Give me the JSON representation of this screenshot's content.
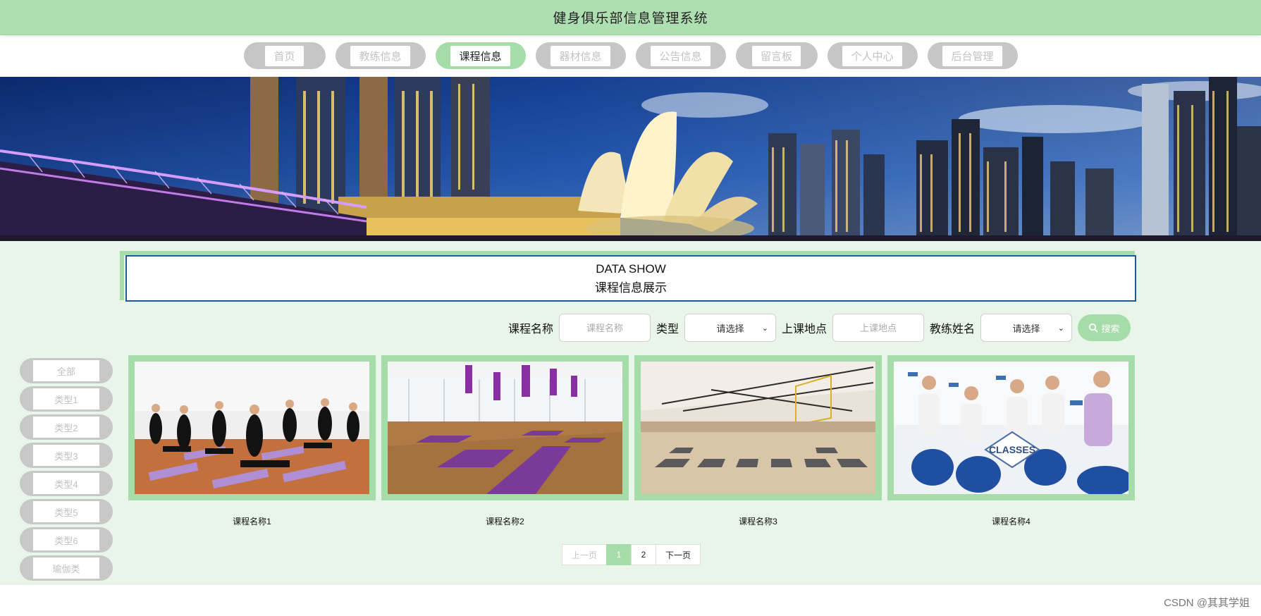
{
  "header": {
    "title": "健身俱乐部信息管理系统"
  },
  "nav": {
    "items": [
      {
        "label": "首页"
      },
      {
        "label": "教练信息"
      },
      {
        "label": "课程信息"
      },
      {
        "label": "器材信息"
      },
      {
        "label": "公告信息"
      },
      {
        "label": "留言板"
      },
      {
        "label": "个人中心"
      },
      {
        "label": "后台管理"
      }
    ],
    "active_index": 2
  },
  "section": {
    "title_en": "DATA SHOW",
    "title_cn": "课程信息展示"
  },
  "search": {
    "course_name_label": "课程名称",
    "course_name_placeholder": "课程名称",
    "type_label": "类型",
    "type_value": "请选择",
    "location_label": "上课地点",
    "location_placeholder": "上课地点",
    "coach_label": "教练姓名",
    "coach_value": "请选择",
    "button_label": "搜索",
    "button_icon": "search-icon"
  },
  "categories": [
    {
      "label": "全部"
    },
    {
      "label": "类型1"
    },
    {
      "label": "类型2"
    },
    {
      "label": "类型3"
    },
    {
      "label": "类型4"
    },
    {
      "label": "类型5"
    },
    {
      "label": "类型6"
    },
    {
      "label": "瑜伽类"
    }
  ],
  "courses": [
    {
      "name": "课程名称1"
    },
    {
      "name": "课程名称2"
    },
    {
      "name": "课程名称3"
    },
    {
      "name": "课程名称4",
      "image_text": "CLASSES"
    }
  ],
  "pagination": {
    "prev": "上一页",
    "pages": [
      "1",
      "2"
    ],
    "current": "1",
    "next": "下一页"
  },
  "footer": {
    "watermark": "CSDN @其其学姐"
  },
  "colors": {
    "accent": "#a5dca8",
    "header_bg": "#aedfb0",
    "main_bg": "#e8f5e8",
    "border_blue": "#1d5a97",
    "inactive": "#c6c6c6"
  }
}
